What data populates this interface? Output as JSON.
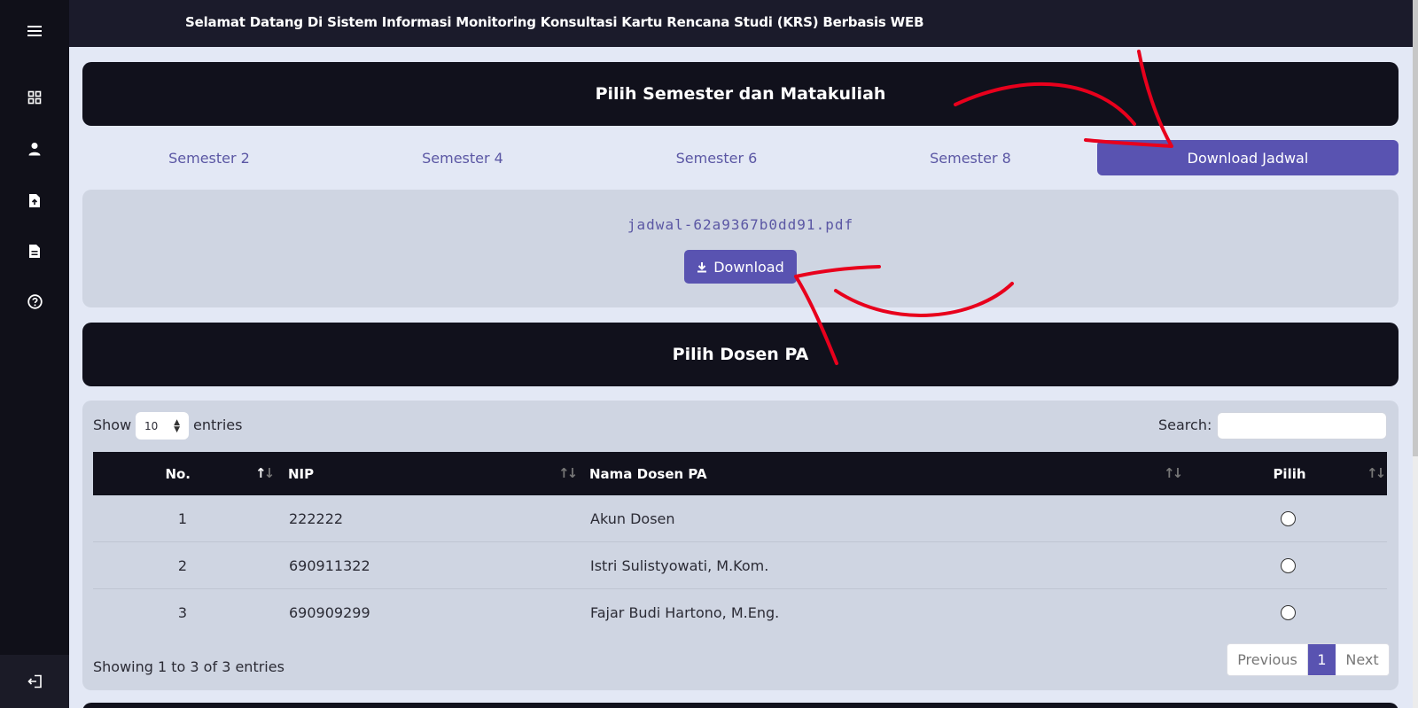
{
  "sidebar": {
    "icons": [
      "menu-icon",
      "dashboard-icon",
      "user-icon",
      "file-upload-icon",
      "document-icon",
      "help-icon"
    ],
    "bottom_icon": "logout-icon"
  },
  "header": {
    "title": "Selamat Datang Di Sistem Informasi Monitoring Konsultasi Kartu Rencana Studi (KRS) Berbasis WEB"
  },
  "section1": {
    "title": "Pilih Semester dan Matakuliah"
  },
  "tabs": [
    {
      "label": "Semester 2"
    },
    {
      "label": "Semester 4"
    },
    {
      "label": "Semester 6"
    },
    {
      "label": "Semester 8"
    },
    {
      "label": "Download Jadwal",
      "active": true
    }
  ],
  "file": {
    "name": "jadwal-62a9367b0dd91.pdf",
    "download_label": "Download"
  },
  "section2": {
    "title": "Pilih Dosen PA"
  },
  "table": {
    "show_label": "Show",
    "length_value": "10",
    "entries_label": "entries",
    "search_label": "Search:",
    "headers": [
      "No.",
      "NIP",
      "Nama Dosen PA",
      "Pilih"
    ],
    "rows": [
      {
        "no": "1",
        "nip": "222222",
        "nama": "Akun Dosen"
      },
      {
        "no": "2",
        "nip": "690911322",
        "nama": "Istri Sulistyowati, M.Kom."
      },
      {
        "no": "3",
        "nip": "690909299",
        "nama": "Fajar Budi Hartono, M.Eng."
      }
    ],
    "info": "Showing 1 to 3 of 3 entries",
    "pagination": {
      "previous": "Previous",
      "current": "1",
      "next": "Next"
    }
  },
  "colors": {
    "accent": "#5953b1",
    "dark": "#11111c",
    "annotation": "#e8001c"
  }
}
